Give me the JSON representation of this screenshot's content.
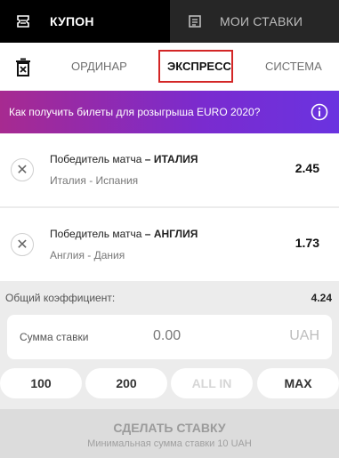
{
  "header": {
    "coupon_label": "КУПОН",
    "my_bets_label": "МОИ СТАВКИ",
    "coupon_icon": "ticket-icon",
    "my_bets_icon": "list-icon"
  },
  "bet_types": {
    "single": "ОРДИНАР",
    "express": "ЭКСПРЕСС",
    "system": "СИСТЕМА",
    "active": "express",
    "clear_icon": "trash-icon"
  },
  "promo": {
    "text": "Как получить билеты для розыгрыша EURO 2020?",
    "icon": "info-icon"
  },
  "selections": [
    {
      "market": "Победитель матча",
      "pick": "ИТАЛИЯ",
      "event": "Италия - Испания",
      "odds": "2.45"
    },
    {
      "market": "Победитель матча",
      "pick": "АНГЛИЯ",
      "event": "Англия - Дания",
      "odds": "1.73"
    }
  ],
  "total": {
    "label": "Общий коэффициент:",
    "value": "4.24"
  },
  "stake": {
    "label": "Сумма ставки",
    "amount": "0.00",
    "currency": "UAH"
  },
  "quick_stakes": [
    "100",
    "200",
    "ALL IN",
    "MAX"
  ],
  "place_bet": {
    "label": "СДЕЛАТЬ СТАВКУ",
    "note": "Минимальная сумма ставки 10 UAH"
  },
  "colors": {
    "highlight": "#d32626",
    "promo_start": "#a72a90",
    "promo_end": "#6a33e0"
  }
}
